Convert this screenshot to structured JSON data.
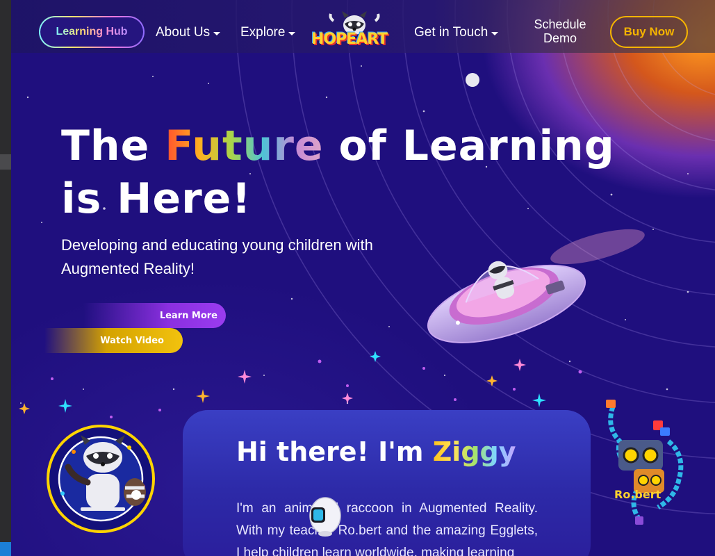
{
  "nav": {
    "learning_hub": "Learning Hub",
    "about": "About Us",
    "explore": "Explore",
    "logo": "HOPEART",
    "get_in_touch": "Get in Touch",
    "schedule_line1": "Schedule",
    "schedule_line2": "Demo",
    "buy_now": "Buy Now"
  },
  "hero": {
    "title_the": "The",
    "title_future": "Future",
    "title_rest1": "of Learning",
    "title_line2": "is Here!",
    "subtitle": "Developing and educating young children with Augmented Reality!",
    "learn_more": "Learn More",
    "watch_video": "Watch Video"
  },
  "intro_card": {
    "title_prefix": "Hi there! I'm",
    "title_name": "Ziggy",
    "body": "I'm an animated raccoon in Augmented Reality. With my teacher Ro.bert and the amazing Egglets, I help children learn worldwide, making learning"
  },
  "characters": {
    "robert_label": "Ro.bert"
  },
  "colors": {
    "accent_yellow": "#f5b400",
    "accent_purple": "#8b2fe0",
    "background": "#1f0f7e"
  },
  "icons": {
    "dropdown": "caret-down-icon"
  }
}
